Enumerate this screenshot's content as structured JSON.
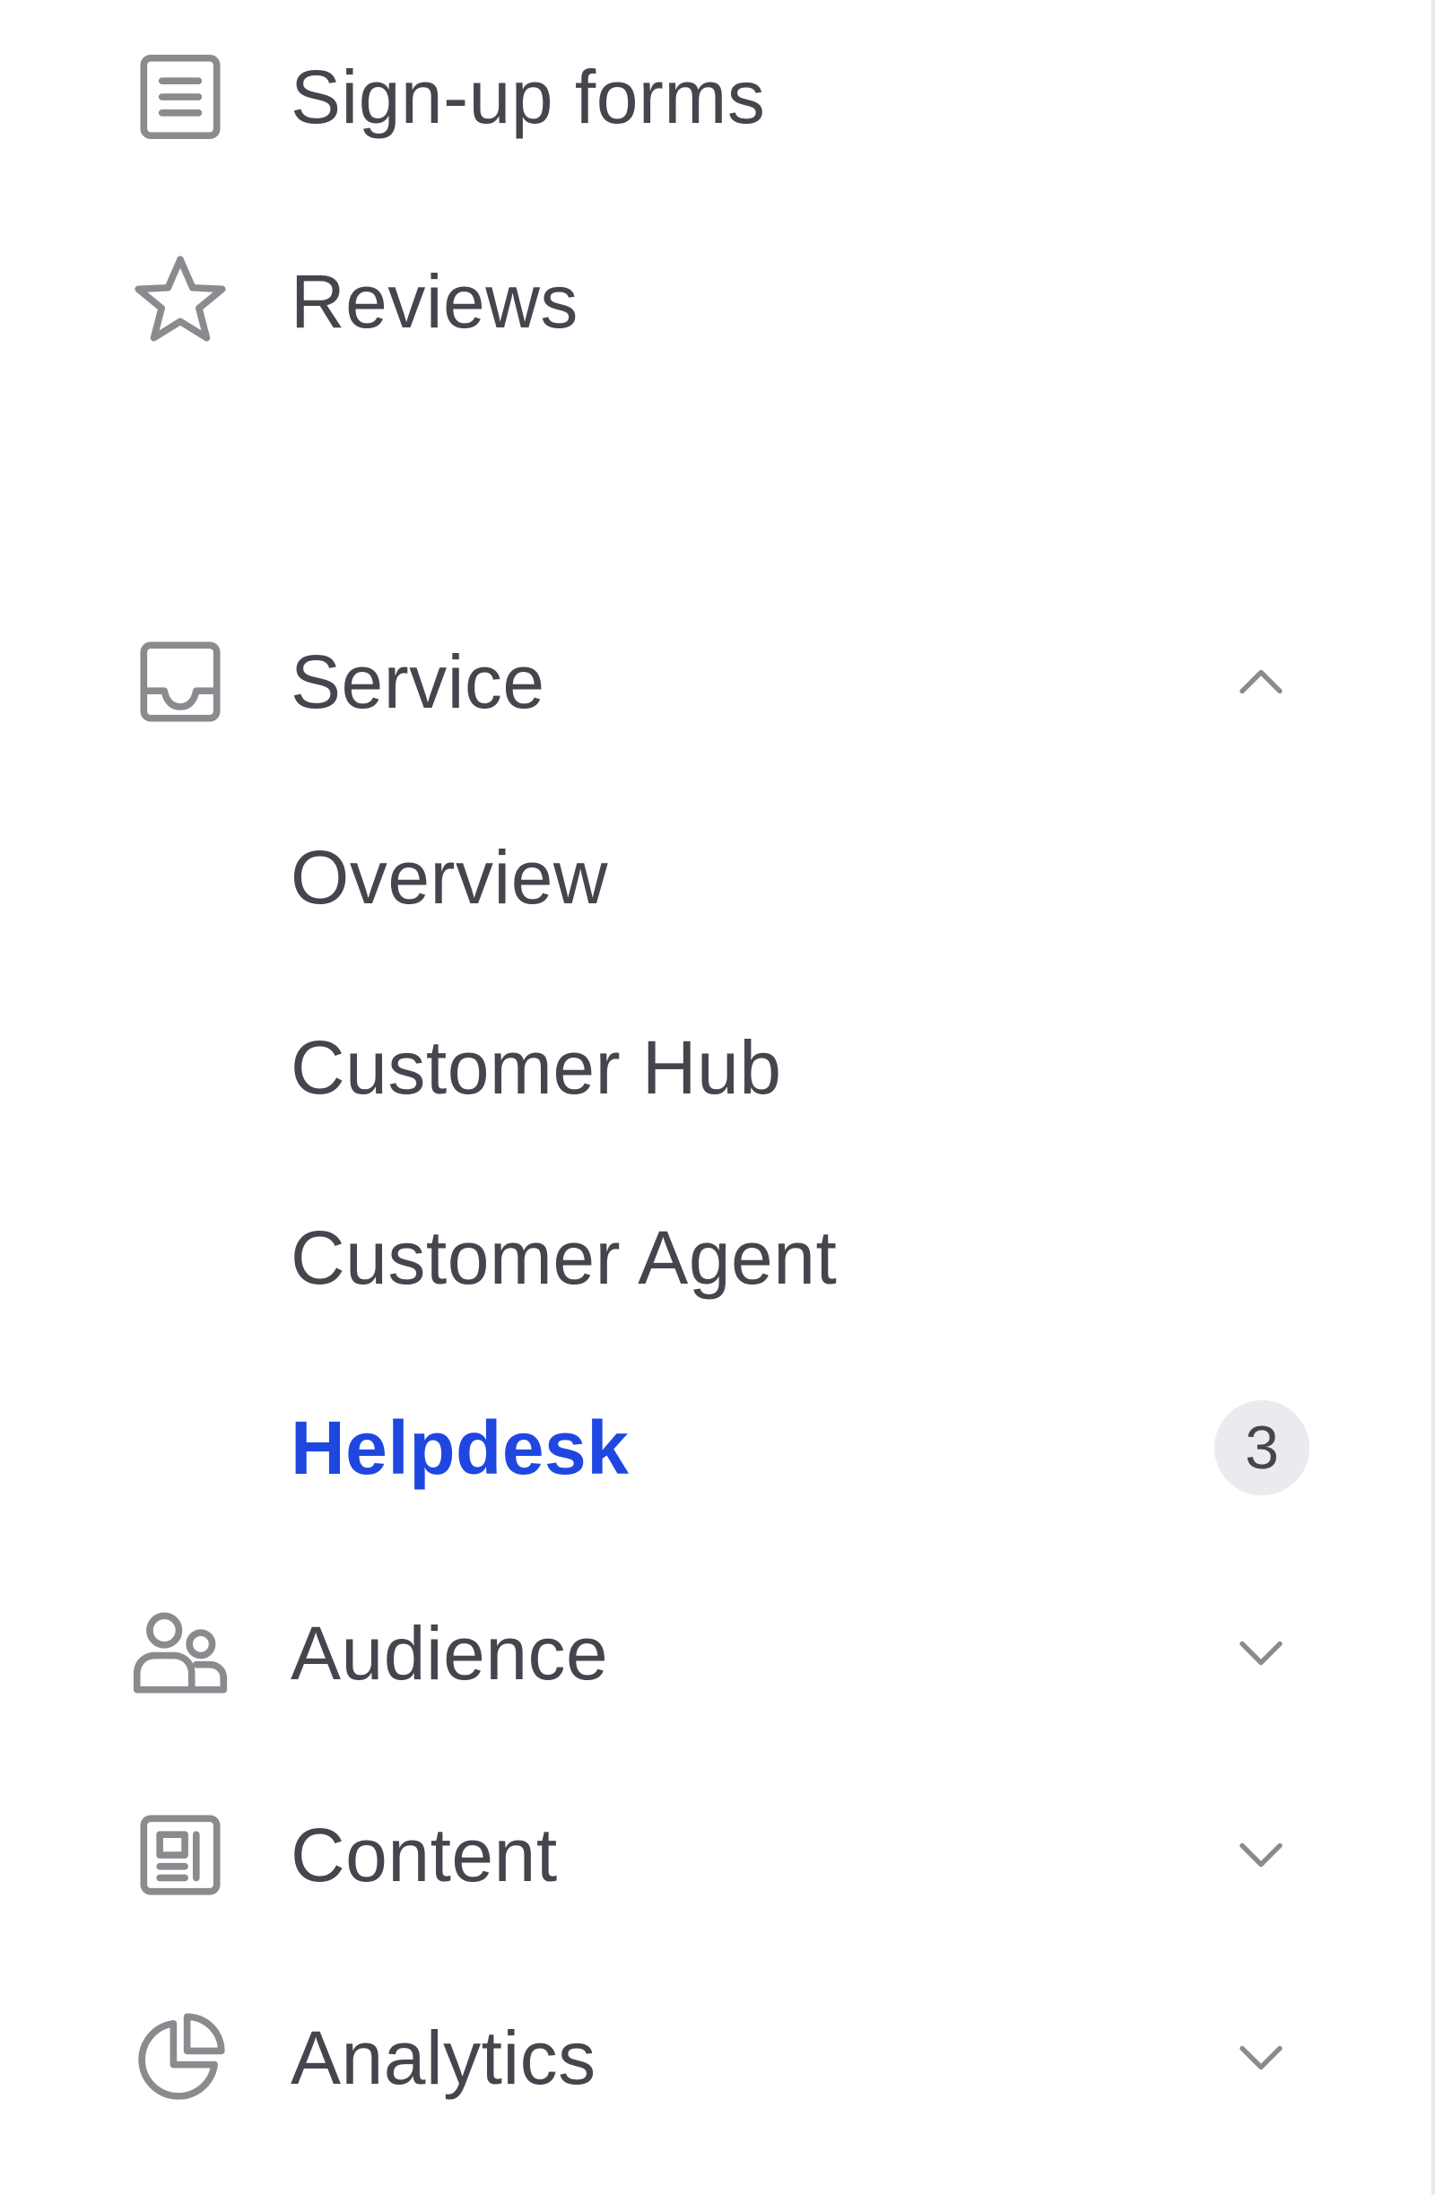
{
  "nav": {
    "items": [
      {
        "label": "Sign-up forms",
        "icon": "form-icon"
      },
      {
        "label": "Reviews",
        "icon": "star-icon"
      },
      {
        "label": "Service",
        "icon": "inbox-icon",
        "chevron": "chevron-up-icon",
        "expanded": true,
        "children": [
          {
            "label": "Overview"
          },
          {
            "label": "Customer Hub"
          },
          {
            "label": "Customer Agent"
          },
          {
            "label": "Helpdesk",
            "active": true,
            "badge": "3"
          }
        ]
      },
      {
        "label": "Audience",
        "icon": "users-icon",
        "chevron": "chevron-down-icon",
        "expanded": false
      },
      {
        "label": "Content",
        "icon": "content-icon",
        "chevron": "chevron-down-icon",
        "expanded": false
      },
      {
        "label": "Analytics",
        "icon": "pie-chart-icon",
        "chevron": "chevron-down-icon",
        "expanded": false
      }
    ]
  },
  "colors": {
    "text": "#45454d",
    "icon": "#8a8a8f",
    "active": "#1f47e0",
    "badge_bg": "#e9ebef",
    "border": "#e9e9eb"
  }
}
